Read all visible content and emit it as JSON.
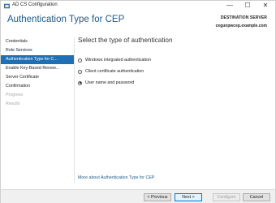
{
  "window": {
    "title": "AD CS Configuration",
    "controls": {
      "minimize": "—",
      "maximize": "☐",
      "close": "✕"
    }
  },
  "header": {
    "title": "Authentication Type for CEP",
    "destination_label": "DESTINATION SERVER",
    "destination_value": "cegunpwcep.example.com"
  },
  "nav": {
    "items": [
      {
        "label": "Credentials",
        "state": "normal"
      },
      {
        "label": "Role Services",
        "state": "normal"
      },
      {
        "label": "Authentication Type for C...",
        "state": "selected"
      },
      {
        "label": "Enable Key-Based Renew...",
        "state": "normal"
      },
      {
        "label": "Server Certificate",
        "state": "normal"
      },
      {
        "label": "Confirmation",
        "state": "normal"
      },
      {
        "label": "Progress",
        "state": "disabled"
      },
      {
        "label": "Results",
        "state": "disabled"
      }
    ]
  },
  "main": {
    "heading": "Select the type of authentication",
    "options": [
      {
        "label": "Windows integrated authentication",
        "selected": false
      },
      {
        "label": "Client certificate authentication",
        "selected": false
      },
      {
        "label": "User name and password",
        "selected": true
      }
    ],
    "more_link": "More about Authentication Type for CEP"
  },
  "footer": {
    "previous": "< Previous",
    "next": "Next >",
    "configure": "Configure",
    "cancel": "Cancel"
  },
  "colors": {
    "accent": "#1f6fb5",
    "header_text": "#1c5a8c"
  }
}
